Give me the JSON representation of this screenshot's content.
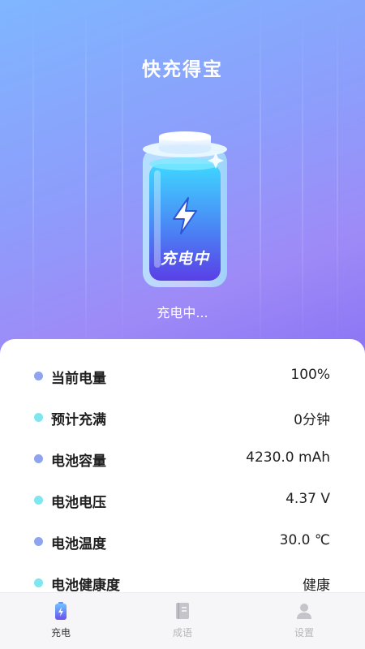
{
  "app": {
    "title": "快充得宝"
  },
  "battery": {
    "badge_text": "充电中",
    "status_text": "充电中..."
  },
  "colors": {
    "dot_blue": "#8ea4ee",
    "dot_cyan": "#7fe6ef",
    "tab_active": "#3b3b3b",
    "tab_inactive": "#b5b5bb"
  },
  "info": {
    "rows": [
      {
        "label": "当前电量",
        "value": "100%"
      },
      {
        "label": "预计充满",
        "value": "0分钟"
      },
      {
        "label": "电池容量",
        "value": "4230.0 mAh"
      },
      {
        "label": "电池电压",
        "value": "4.37 V"
      },
      {
        "label": "电池温度",
        "value": "30.0 ℃"
      },
      {
        "label": "电池健康度",
        "value": "健康"
      }
    ]
  },
  "tabs": [
    {
      "label": "充电",
      "icon": "battery-charge-icon",
      "active": true
    },
    {
      "label": "成语",
      "icon": "book-icon",
      "active": false
    },
    {
      "label": "设置",
      "icon": "person-icon",
      "active": false
    }
  ]
}
